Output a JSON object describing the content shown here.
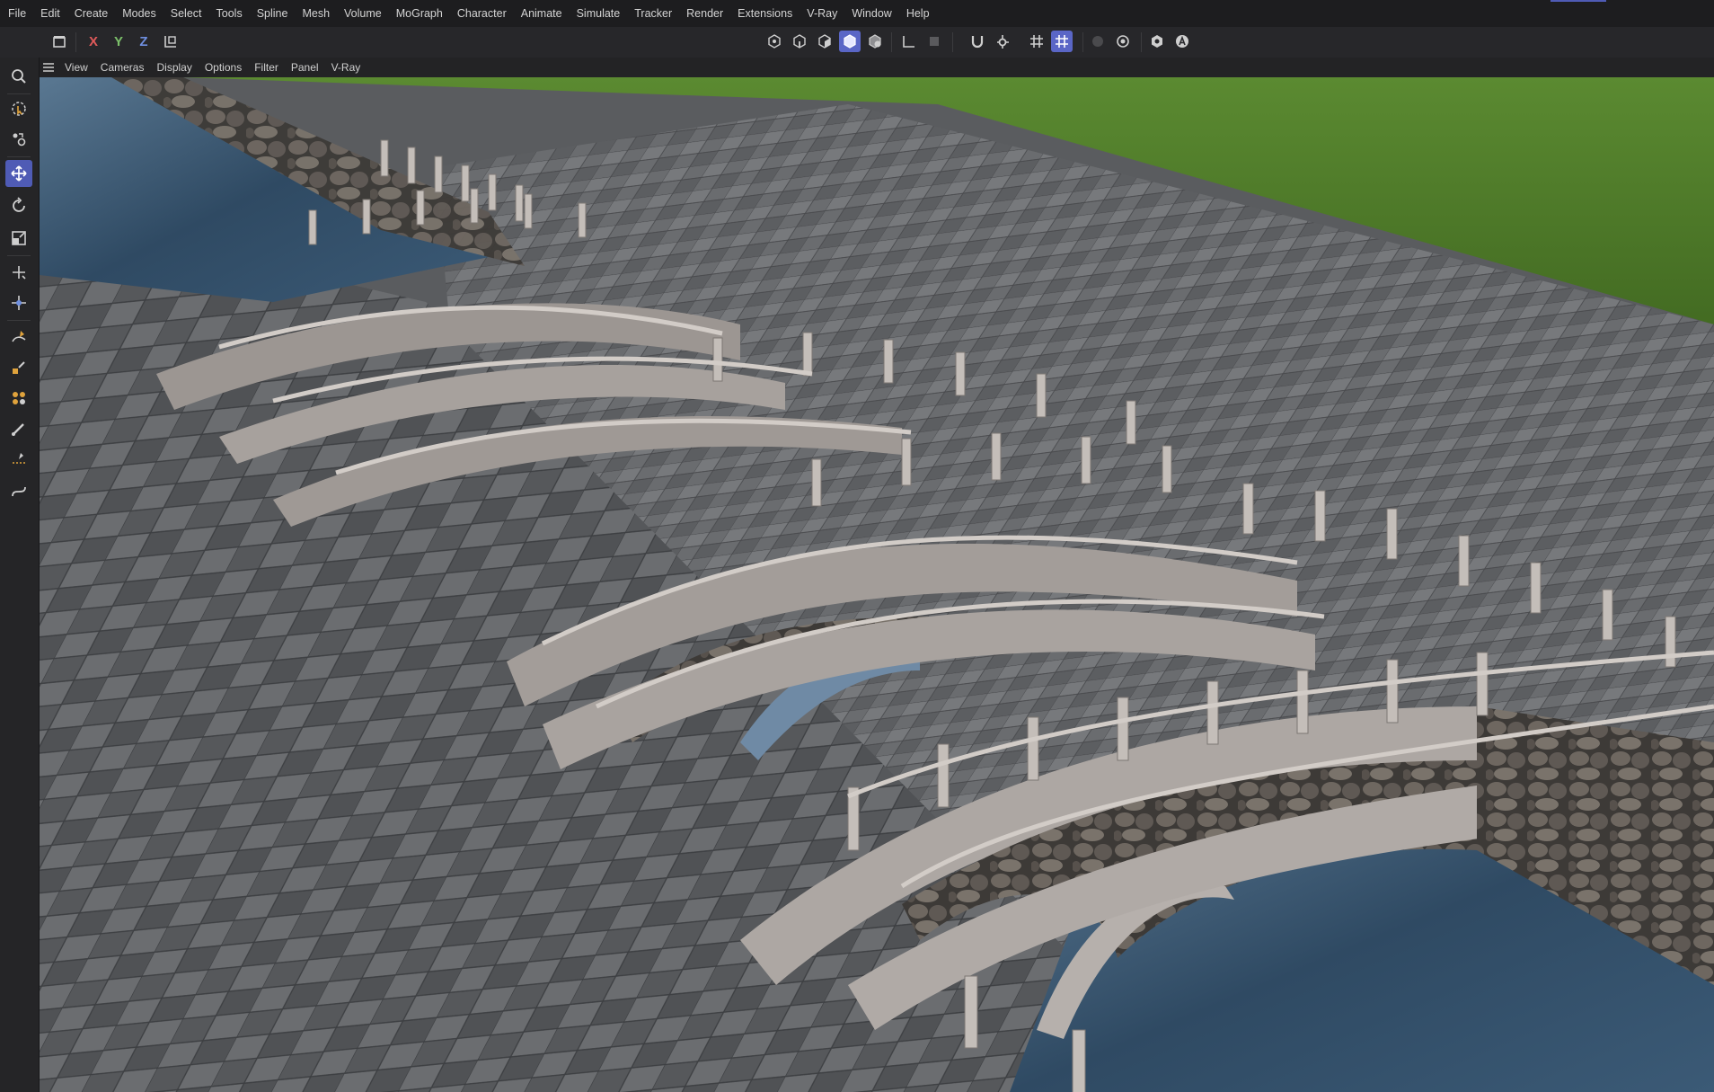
{
  "menu": [
    "File",
    "Edit",
    "Create",
    "Modes",
    "Select",
    "Tools",
    "Spline",
    "Mesh",
    "Volume",
    "MoGraph",
    "Character",
    "Animate",
    "Simulate",
    "Tracker",
    "Render",
    "Extensions",
    "V-Ray",
    "Window",
    "Help"
  ],
  "toolbar": {
    "axes": [
      {
        "label": "X",
        "color": "#e05a5a"
      },
      {
        "label": "Y",
        "color": "#7cc16a"
      },
      {
        "label": "Z",
        "color": "#6f8fe0"
      }
    ],
    "icons": [
      "undo-view-icon",
      "coordinate-system-icon",
      "points-mode-icon",
      "edges-mode-icon",
      "polygons-mode-icon",
      "model-mode-icon",
      "uv-mode-icon",
      "axis-mode-icon",
      "object-mode-icon",
      "snap-magnet-icon",
      "snap-settings-icon",
      "workplane-grid-icon",
      "workplane-snap-icon",
      "render-region-icon",
      "render-settings-icon",
      "vray-material-icon",
      "vray-render-icon"
    ]
  },
  "viewport_menu": [
    "View",
    "Cameras",
    "Display",
    "Options",
    "Filter",
    "Panel",
    "V-Ray"
  ],
  "left_tools": [
    "search-icon",
    "live-selection-icon",
    "scale-points-icon",
    "move-tool-icon",
    "rotate-tool-icon",
    "scale-tool-icon",
    "move-axis-icon",
    "transform-tool-icon",
    "pen-tool-icon",
    "paint-tool-icon",
    "sculpt-tool-icon",
    "brush-tool-icon",
    "knife-tool-icon",
    "spline-tool-icon"
  ],
  "colors": {
    "accent": "#5a66c6",
    "menubar_bg": "#1d1d1f",
    "toolbar_bg": "#27272a",
    "grass": "#4f7a2d",
    "water": "#34506a",
    "paving": "#5e6063",
    "stone_rail": "#a59f9c"
  }
}
